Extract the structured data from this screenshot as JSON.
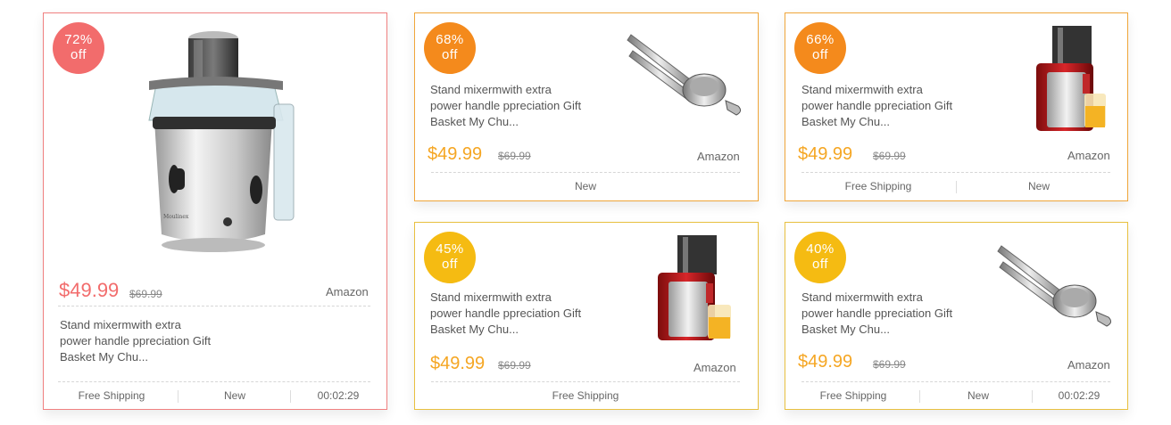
{
  "colors": {
    "red": "#f26c6c",
    "orange": "#f48a1c",
    "amber": "#f5a623",
    "yellow": "#f5bb12"
  },
  "cards": [
    {
      "badge_pct": "72%",
      "badge_off": "off",
      "title": [
        "Stand mixermwith extra",
        "power handle ppreciation Gift",
        "Basket My Chu..."
      ],
      "price": "$49.99",
      "old_price": "$69.99",
      "store": "Amazon",
      "footer": [
        "Free Shipping",
        "New",
        "00:02:29"
      ],
      "icon": "juicer-silver-icon"
    },
    {
      "badge_pct": "68%",
      "badge_off": "off",
      "title": [
        "Stand mixermwith extra",
        "power handle ppreciation Gift",
        "Basket My Chu..."
      ],
      "price": "$49.99",
      "old_price": "$69.99",
      "store": "Amazon",
      "footer": [
        "New"
      ],
      "icon": "lemon-squeezer-icon"
    },
    {
      "badge_pct": "66%",
      "badge_off": "off",
      "title": [
        "Stand mixermwith extra",
        "power handle ppreciation Gift",
        "Basket My Chu..."
      ],
      "price": "$49.99",
      "old_price": "$69.99",
      "store": "Amazon",
      "footer": [
        "Free Shipping",
        "New"
      ],
      "icon": "juicer-red-icon"
    },
    {
      "badge_pct": "45%",
      "badge_off": "off",
      "title": [
        "Stand mixermwith extra",
        "power handle ppreciation Gift",
        "Basket My Chu..."
      ],
      "price": "$49.99",
      "old_price": "$69.99",
      "store": "Amazon",
      "footer": [
        "Free Shipping"
      ],
      "icon": "juicer-red-icon"
    },
    {
      "badge_pct": "40%",
      "badge_off": "off",
      "title": [
        "Stand mixermwith extra",
        "power handle ppreciation Gift",
        "Basket My Chu..."
      ],
      "price": "$49.99",
      "old_price": "$69.99",
      "store": "Amazon",
      "footer": [
        "Free Shipping",
        "New",
        "00:02:29"
      ],
      "icon": "lemon-squeezer-icon"
    }
  ]
}
